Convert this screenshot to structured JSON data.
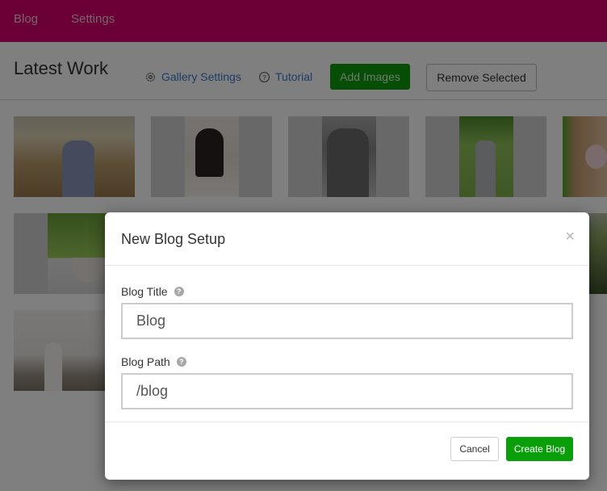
{
  "topnav": {
    "items": [
      {
        "label": "Blog"
      },
      {
        "label": "Settings"
      }
    ],
    "brand_color": "#d6006c"
  },
  "page": {
    "title": "Latest Work",
    "gallery_settings_label": "Gallery Settings",
    "tutorial_label": "Tutorial",
    "add_images_label": "Add Images",
    "remove_selected_label": "Remove Selected"
  },
  "gallery": {
    "thumbnails": [
      {
        "subject": "couple-on-beach"
      },
      {
        "subject": "woman-with-cake"
      },
      {
        "subject": "couple-black-and-white"
      },
      {
        "subject": "groom-by-fence"
      },
      {
        "subject": "bouquet-on-chair"
      },
      {
        "subject": "flower-bowl-by-window"
      },
      {
        "subject": "grass-detail"
      },
      {
        "subject": "bride-by-driftwood"
      }
    ]
  },
  "modal": {
    "title": "New Blog Setup",
    "close_glyph": "×",
    "fields": [
      {
        "label": "Blog Title",
        "value": "Blog"
      },
      {
        "label": "Blog Path",
        "value": "/blog"
      }
    ],
    "help_glyph": "?",
    "cancel_label": "Cancel",
    "create_label": "Create Blog",
    "accent_color": "#0a9e0a"
  }
}
